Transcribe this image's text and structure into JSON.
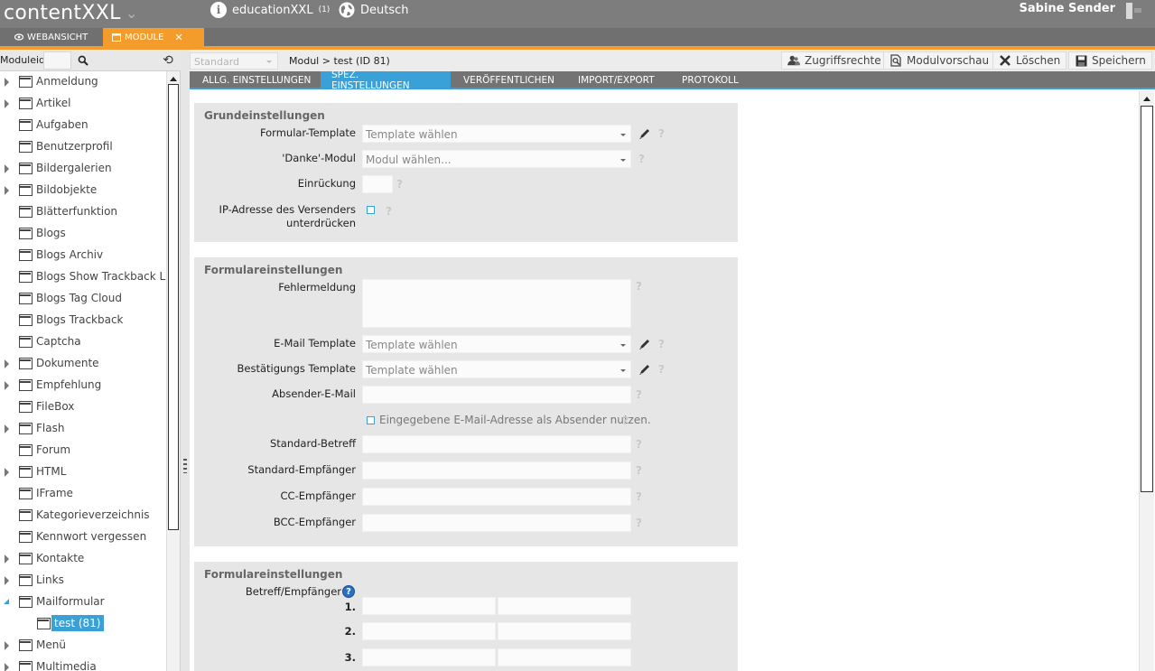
{
  "header": {
    "logo": "contentXXL",
    "site": "educationXXL",
    "site_sup": "(1)",
    "language": "Deutsch",
    "user": "Sabine Sender"
  },
  "tabs": {
    "webansicht": "WEBANSICHT",
    "module": "MODULE"
  },
  "left": {
    "search_label": "Moduleid:",
    "items": [
      {
        "label": "Anmeldung",
        "expandable": true
      },
      {
        "label": "Artikel",
        "expandable": true
      },
      {
        "label": "Aufgaben",
        "expandable": false
      },
      {
        "label": "Benutzerprofil",
        "expandable": false
      },
      {
        "label": "Bildergalerien",
        "expandable": true
      },
      {
        "label": "Bildobjekte",
        "expandable": true
      },
      {
        "label": "Blätterfunktion",
        "expandable": false
      },
      {
        "label": "Blogs",
        "expandable": false
      },
      {
        "label": "Blogs Archiv",
        "expandable": false
      },
      {
        "label": "Blogs Show Trackback Link",
        "expandable": false
      },
      {
        "label": "Blogs Tag Cloud",
        "expandable": false
      },
      {
        "label": "Blogs Trackback",
        "expandable": false
      },
      {
        "label": "Captcha",
        "expandable": false
      },
      {
        "label": "Dokumente",
        "expandable": true
      },
      {
        "label": "Empfehlung",
        "expandable": true
      },
      {
        "label": "FileBox",
        "expandable": false
      },
      {
        "label": "Flash",
        "expandable": true
      },
      {
        "label": "Forum",
        "expandable": false
      },
      {
        "label": "HTML",
        "expandable": true
      },
      {
        "label": "IFrame",
        "expandable": false
      },
      {
        "label": "Kategorieverzeichnis",
        "expandable": false
      },
      {
        "label": "Kennwort vergessen",
        "expandable": false
      },
      {
        "label": "Kontakte",
        "expandable": true
      },
      {
        "label": "Links",
        "expandable": true
      },
      {
        "label": "Mailformular",
        "expandable": true,
        "open": true
      },
      {
        "label": "test (81)",
        "child": true
      },
      {
        "label": "Menü",
        "expandable": true
      },
      {
        "label": "Multimedia",
        "expandable": true
      }
    ]
  },
  "toolbar": {
    "standard": "Standard",
    "breadcrumb": "Modul > test (ID 81)",
    "zugriffsrechte": "Zugriffsrechte",
    "modulvorschau": "Modulvorschau",
    "loeschen": "Löschen",
    "speichern": "Speichern"
  },
  "subtabs": {
    "allg": "ALLG. EINSTELLUNGEN",
    "spez": "SPEZ. EINSTELLUNGEN",
    "veroeff": "VERÖFFENTLICHEN",
    "import": "IMPORT/EXPORT",
    "protokoll": "PROTOKOLL"
  },
  "sections": {
    "grund": {
      "title": "Grundeinstellungen",
      "formular_template_label": "Formular-Template",
      "formular_template_value": "Template wählen",
      "danke_label": "'Danke'-Modul",
      "danke_value": "Modul wählen...",
      "einrueckung_label": "Einrückung",
      "ip_label_1": "IP-Adresse des Versenders",
      "ip_label_2": "unterdrücken"
    },
    "formular1": {
      "title": "Formulareinstellungen",
      "fehlermeldung_label": "Fehlermeldung",
      "email_template_label": "E-Mail Template",
      "email_template_value": "Template wählen",
      "best_template_label": "Bestätigungs Template",
      "best_template_value": "Template wählen",
      "absender_label": "Absender-E-Mail",
      "checkbox_label": "Eingegebene E-Mail-Adresse als Absender nutzen.",
      "betreff_label": "Standard-Betreff",
      "empfaenger_label": "Standard-Empfänger",
      "cc_label": "CC-Empfänger",
      "bcc_label": "BCC-Empfänger"
    },
    "formular2": {
      "title": "Formulareinstellungen",
      "be_label": "Betreff/Empfänger",
      "rows": [
        "1.",
        "2.",
        "3."
      ]
    }
  },
  "help_glyph": "?",
  "close_glyph": "✕",
  "colors": {
    "accent_orange": "#f39b2b",
    "accent_blue": "#3aa0d8",
    "header_gray": "#7d7d7d"
  }
}
